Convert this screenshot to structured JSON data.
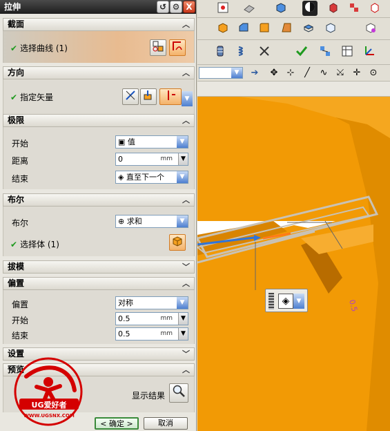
{
  "dialog": {
    "title": "拉伸",
    "buttons": {
      "close": "X",
      "settings": "⚙",
      "reset": "↺"
    },
    "sections": {
      "section": {
        "title": "截面",
        "select_curve": "选择曲线 (1)"
      },
      "direction": {
        "title": "方向",
        "specify_vector": "指定矢量"
      },
      "limits": {
        "title": "极限",
        "start_label": "开始",
        "start_value": "值",
        "distance_label": "距离",
        "distance_value": "0",
        "distance_unit": "mm",
        "end_label": "结束",
        "end_value": "直至下一个"
      },
      "boolean": {
        "title": "布尔",
        "boolean_label": "布尔",
        "boolean_value": "求和",
        "select_body": "选择体 (1)"
      },
      "draft": {
        "title": "拔模"
      },
      "offset": {
        "title": "偏置",
        "offset_label": "偏置",
        "offset_value": "对称",
        "start_label": "开始",
        "start_value": "0.5",
        "start_unit": "mm",
        "end_label": "结束",
        "end_value": "0.5",
        "end_unit": "mm"
      },
      "settings": {
        "title": "设置"
      },
      "preview": {
        "title": "预览",
        "show_result": "显示结果"
      }
    },
    "ok": "< 确定 >",
    "cancel": "取消"
  },
  "viewport": {
    "dimension_label": "0.5",
    "colors": {
      "part_orange": "#f29a05",
      "part_shadow": "#b86c00",
      "edge_gray": "#c9c2b5",
      "vector_blue": "#2f74d9"
    }
  },
  "watermark": {
    "brand": "UG爱好者",
    "url": "WWW.UGSNX.COM",
    "color": "#d40000"
  }
}
